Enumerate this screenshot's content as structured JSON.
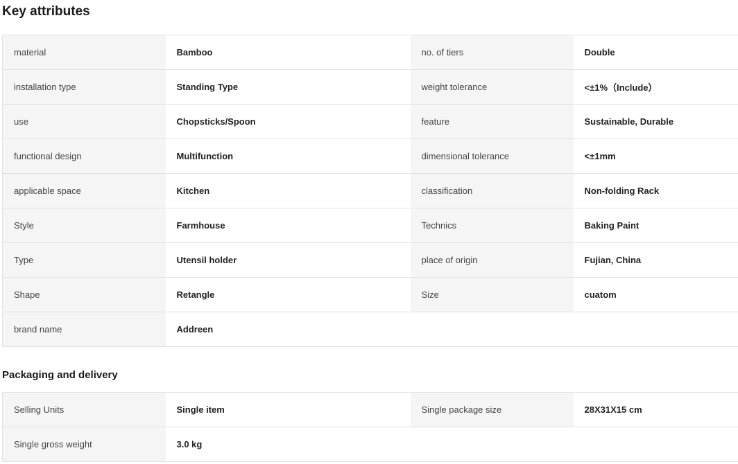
{
  "sections": {
    "key_attributes": {
      "title": "Key attributes",
      "rows": [
        {
          "k1": "material",
          "v1": "Bamboo",
          "k2": "no. of tiers",
          "v2": "Double"
        },
        {
          "k1": "installation type",
          "v1": "Standing Type",
          "k2": "weight tolerance",
          "v2": "<±1%（Include）"
        },
        {
          "k1": "use",
          "v1": "Chopsticks/Spoon",
          "k2": "feature",
          "v2": "Sustainable, Durable"
        },
        {
          "k1": "functional design",
          "v1": "Multifunction",
          "k2": "dimensional tolerance",
          "v2": "<±1mm"
        },
        {
          "k1": "applicable space",
          "v1": "Kitchen",
          "k2": "classification",
          "v2": "Non-folding Rack"
        },
        {
          "k1": "Style",
          "v1": "Farmhouse",
          "k2": "Technics",
          "v2": "Baking Paint"
        },
        {
          "k1": "Type",
          "v1": "Utensil holder",
          "k2": "place of origin",
          "v2": "Fujian, China"
        },
        {
          "k1": "Shape",
          "v1": "Retangle",
          "k2": "Size",
          "v2": "cuatom"
        },
        {
          "k1": "brand name",
          "v1": "Addreen",
          "k2": "",
          "v2": ""
        }
      ]
    },
    "packaging": {
      "title": "Packaging and delivery",
      "rows": [
        {
          "k1": "Selling Units",
          "v1": "Single item",
          "k2": "Single package size",
          "v2": "28X31X15 cm"
        },
        {
          "k1": "Single gross weight",
          "v1": "3.0 kg",
          "k2": "",
          "v2": ""
        }
      ]
    }
  }
}
